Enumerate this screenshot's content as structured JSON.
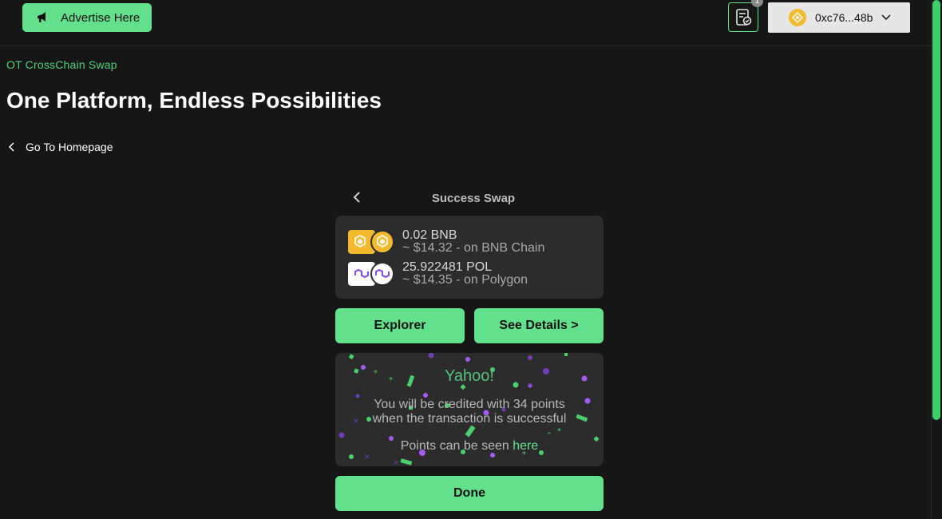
{
  "header": {
    "advertise_label": "Advertise Here",
    "notification_count": "1",
    "wallet_address": "0xc76...48b"
  },
  "breadcrumb": {
    "label": "OT CrossChain Swap"
  },
  "page": {
    "title": "One Platform, Endless Possibilities",
    "back_label": "Go To Homepage"
  },
  "swap": {
    "title": "Success Swap",
    "from": {
      "amount": "0.02 BNB",
      "detail": "~ $14.32 - on BNB Chain"
    },
    "to": {
      "amount": "25.922481 POL",
      "detail": "~ $14.35 - on Polygon"
    },
    "explorer_label": "Explorer",
    "details_label": "See Details >",
    "done_label": "Done"
  },
  "points": {
    "title": "Yahoo!",
    "line1": "You will be credited with 34 points",
    "line2": "when the transaction is successful",
    "line3_prefix": "Points can be seen ",
    "line3_link": "here"
  },
  "colors": {
    "accent": "#63e08c",
    "background": "#161616",
    "card": "#2c2c2c",
    "bnb": "#f3ba2f",
    "polygon": "#8247e5"
  },
  "icons": {
    "advertise": "megaphone-icon",
    "notification": "checklist-icon",
    "wallet_coin": "bnb-icon",
    "wallet_chevron": "chevron-down-icon",
    "back": "chevron-left-icon"
  }
}
